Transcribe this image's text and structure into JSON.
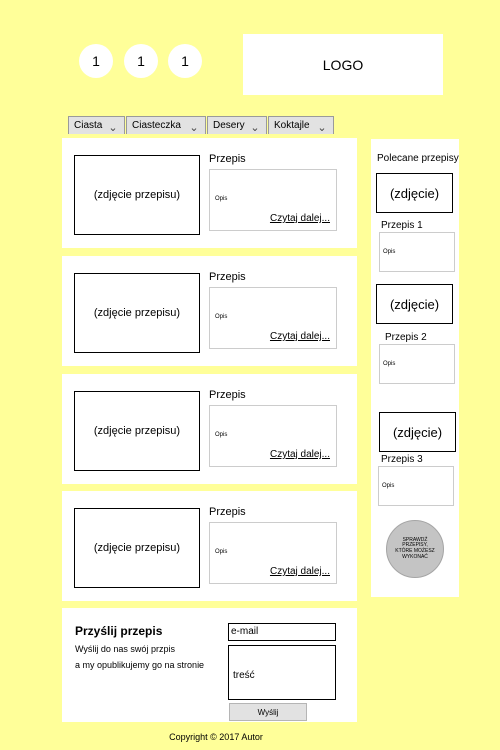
{
  "header": {
    "counters": [
      "1",
      "1",
      "1"
    ],
    "logo": "LOGO"
  },
  "menu": [
    {
      "label": "Ciasta",
      "icon": "chevron-down-icon"
    },
    {
      "label": "Ciasteczka",
      "icon": "chevron-down-icon"
    },
    {
      "label": "Desery",
      "icon": "chevron-down-icon"
    },
    {
      "label": "Koktajle",
      "icon": "chevron-down-icon"
    }
  ],
  "recipes": [
    {
      "photo": "(zdjęcie przepisu)",
      "title": "Przepis",
      "desc": "Opis",
      "more": "Czytaj dalej..."
    },
    {
      "photo": "(zdjęcie przepisu)",
      "title": "Przepis",
      "desc": "Opis",
      "more": "Czytaj dalej..."
    },
    {
      "photo": "(zdjęcie przepisu)",
      "title": "Przepis",
      "desc": "Opis",
      "more": "Czytaj dalej..."
    },
    {
      "photo": "(zdjęcie przepisu)",
      "title": "Przepis",
      "desc": "Opis",
      "more": "Czytaj dalej..."
    }
  ],
  "submit": {
    "title": "Przyślij przepis",
    "line1": "Wyślij do nas swój przpis",
    "line2": "a my opublikujemy go na stronie",
    "email": "e-mail",
    "content": "treść",
    "button": "Wyślij"
  },
  "sidebar": {
    "heading": "Polecane przepisy",
    "items": [
      {
        "photo": "(zdjęcie)",
        "name": "Przepis 1",
        "desc": "Opis"
      },
      {
        "photo": "(zdjęcie)",
        "name": "Przepis 2",
        "desc": "Opis"
      },
      {
        "photo": "(zdjęcie)",
        "name": "Przepis 3",
        "desc": "Opis"
      }
    ],
    "badge": "SPRAWDŹ PRZEPISY, KTÓRE MOŻESZ WYKONAĆ"
  },
  "footer": "Copyright © 2017 Autor"
}
